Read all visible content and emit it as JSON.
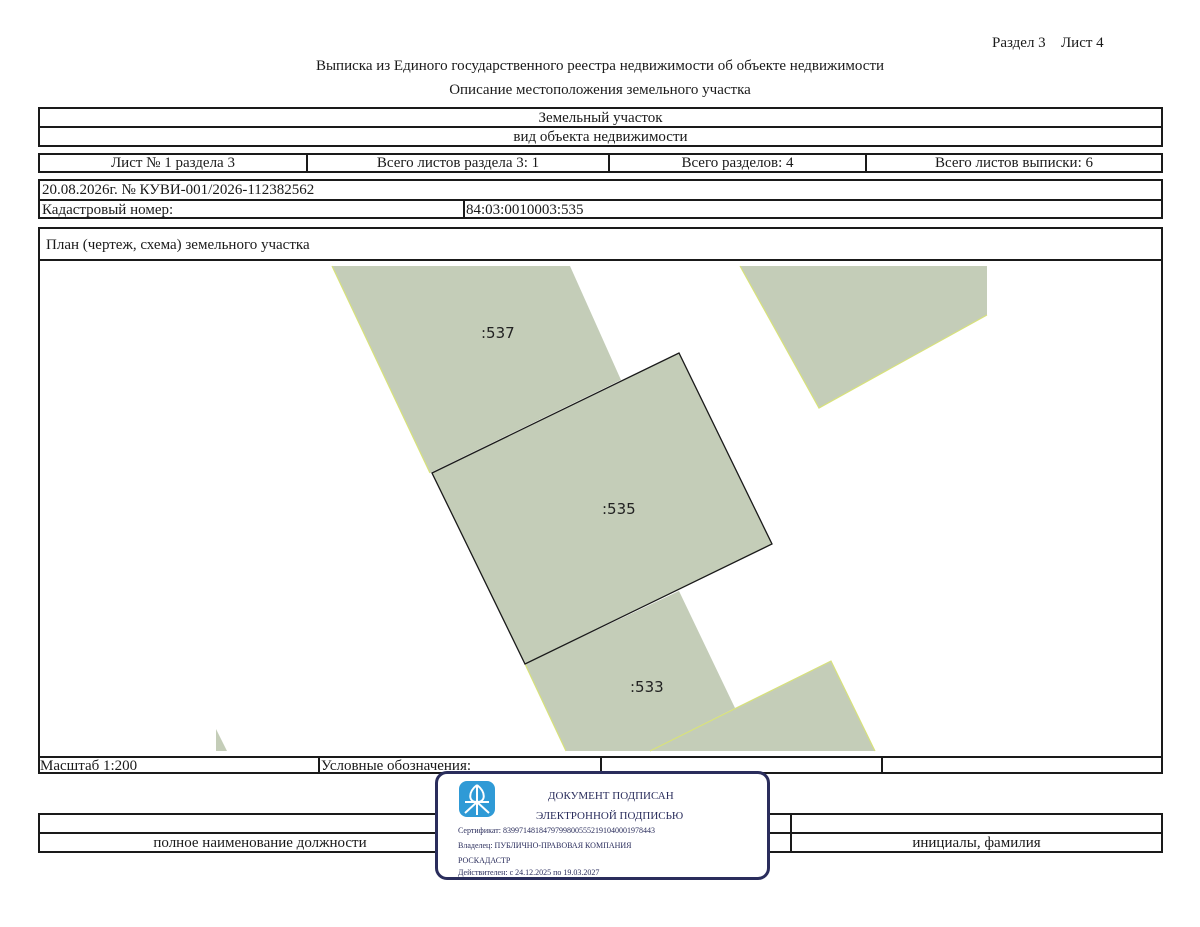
{
  "header": {
    "section_ref": "Раздел 3",
    "sheet_ref": "Лист 4",
    "title": "Выписка из Единого государственного реестра недвижимости об объекте недвижимости",
    "subtitle": "Описание местоположения земельного участка"
  },
  "object": {
    "kind": "Земельный участок",
    "kind_caption": "вид объекта недвижимости"
  },
  "sheet_info": {
    "sheet_of_section": "Лист № 1 раздела 3",
    "total_sheets_section": "Всего листов раздела 3: 1",
    "total_sections": "Всего разделов: 4",
    "total_sheets_extract": "Всего листов выписки: 6"
  },
  "record": {
    "date_number": "20.08.2026г. № КУВИ-001/2026-112382562",
    "cadastral_label": "Кадастровый номер:",
    "cadastral_value": "84:03:0010003:535"
  },
  "plan": {
    "title": "План (чертеж, схема) земельного участка",
    "parcels": [
      {
        "id": "537",
        "label": ":537"
      },
      {
        "id": "535",
        "label": ":535"
      },
      {
        "id": "533",
        "label": ":533"
      }
    ],
    "colors": {
      "parcel_fill": "#c4cdb8",
      "parcel_edge": "#d8e27a",
      "target_edge": "#1a1a1a"
    }
  },
  "footer": {
    "scale": "Масштаб 1:200",
    "legend_label": "Условные обозначения:",
    "position_caption": "полное наименование должности",
    "name_caption": "инициалы, фамилия"
  },
  "stamp": {
    "line1": "ДОКУМЕНТ ПОДПИСАН",
    "line2": "ЭЛЕКТРОННОЙ ПОДПИСЬЮ",
    "certificate": "Сертификат: 83997148184797998005552191040001978443",
    "owner_line1": "Владелец: ПУБЛИЧНО-ПРАВОВАЯ КОМПАНИЯ",
    "owner_line2": "РОСКАДАСТР",
    "validity": "Действителен: с 24.12.2025 по 19.03.2027",
    "logo": "emblem-icon",
    "color": "#2a2d5c"
  }
}
